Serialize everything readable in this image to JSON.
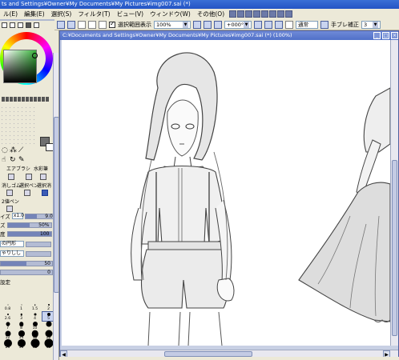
{
  "app": {
    "title": "ts and Settings¥Owner¥My Documents¥My Pictures¥img007.sai (*)"
  },
  "menu": {
    "items": [
      "ル(E)",
      "編集(E)",
      "選択(S)",
      "フィルタ(T)",
      "ビュー(V)",
      "ウィンドウ(W)",
      "その他(O)"
    ]
  },
  "toolbar": {
    "selection_label": "選択範囲表示",
    "zoom": "100%",
    "angle": "+000°",
    "blend": "通常",
    "stabilizer_label": "手ブレ補正",
    "stabilizer_value": "3"
  },
  "tools": {
    "airbrush": "エアブラシ",
    "watercolor": "水彩筆",
    "eraser": "消しゴム",
    "select_pen": "選択ペン",
    "select_erase": "選択消",
    "fill": "バケツ",
    "binary_pen": "2値ペン"
  },
  "properties": {
    "size_label": "イズ",
    "size_mult": "x1.0",
    "size_value": "9.0",
    "min_size_label": "ズ",
    "min_size_value": "50%",
    "density_label": "度",
    "density_value": "100",
    "shape_label": "の円形",
    "texture_label": "ゃりしし",
    "blend_value": "50",
    "persistence_value": "0",
    "detail_label": "設定"
  },
  "brush_sizes": {
    "labels": [
      "0.8",
      "1",
      "1.5",
      "2",
      "2.6",
      "3",
      "4",
      "5",
      "7",
      "8",
      "10",
      "",
      "12",
      "14",
      "16",
      "20",
      "25",
      "30",
      "35",
      "40"
    ],
    "selected_label": "5"
  },
  "canvas": {
    "title": "C:¥Documents and Settings¥Owner¥My Documents¥My Pictures¥img007.sai (*) (100%)"
  },
  "colors": {
    "accent": "#3a6fd6",
    "panel_bg": "#ece9d8",
    "current_fg": "#6f6f6f",
    "current_bg": "#ffffff"
  }
}
